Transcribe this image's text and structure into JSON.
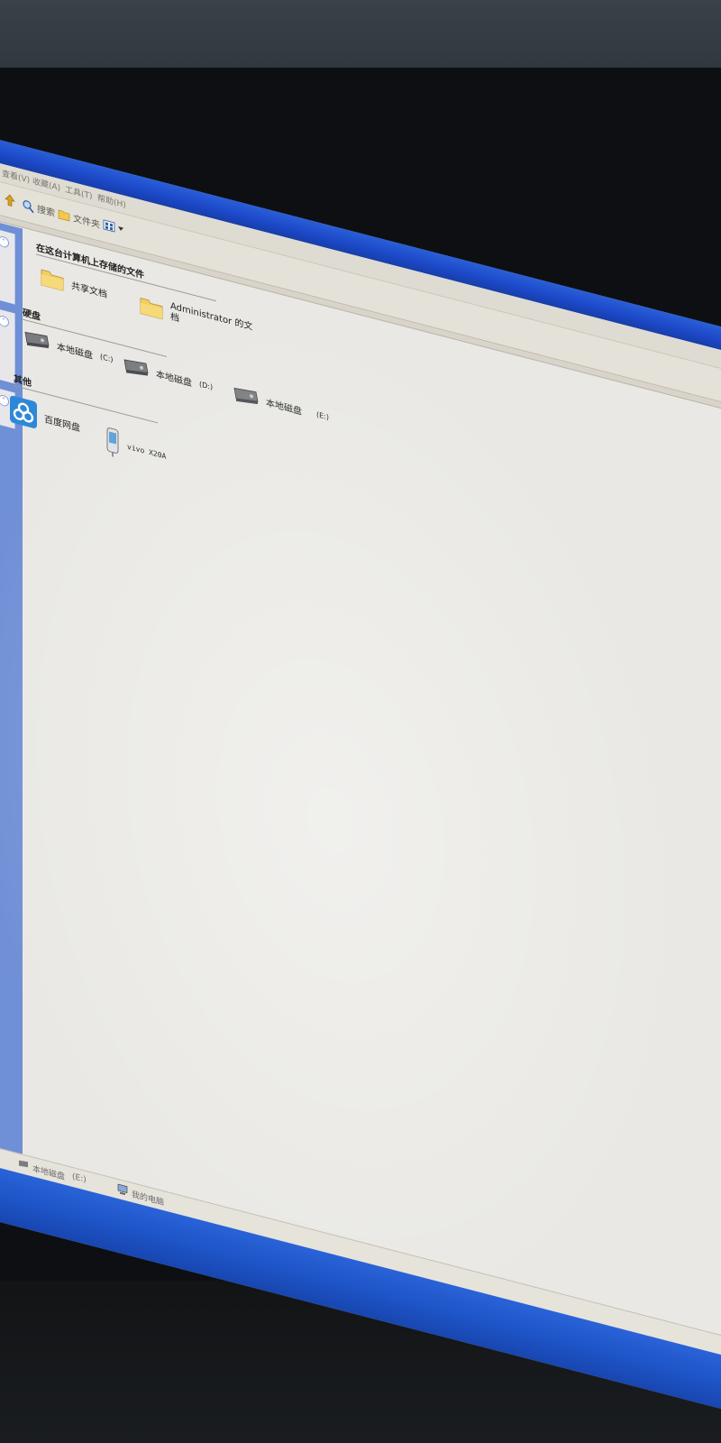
{
  "menu": {
    "file": "查看(V)",
    "favorites": "收藏(A)",
    "tools": "工具(T)",
    "help": "帮助(H)"
  },
  "toolbar": {
    "search": "搜索",
    "folders": "文件夹"
  },
  "groups": {
    "stored_files": "在这台计算机上存储的文件",
    "hard_drives": "硬盘",
    "other": "其他"
  },
  "items": {
    "shared_docs": "共享文档",
    "admin_docs_line1": "Administrator 的文",
    "admin_docs_line2": "档",
    "drive_c_name": "本地磁盘",
    "drive_c_letter": "(C:)",
    "drive_d_name": "本地磁盘",
    "drive_d_letter": "(D:)",
    "drive_e_name": "本地磁盘",
    "drive_e_letter": "(E:)",
    "baidu": "百度网盘",
    "phone": "vivo X20A"
  },
  "status": {
    "drive": "本地磁盘",
    "drive_letter": "(E:)",
    "computer": "我的电脑"
  },
  "colors": {
    "xp_blue": "#1c48c8",
    "screen_bg": "#e9e8e4",
    "bezel": "#0d0f12"
  }
}
